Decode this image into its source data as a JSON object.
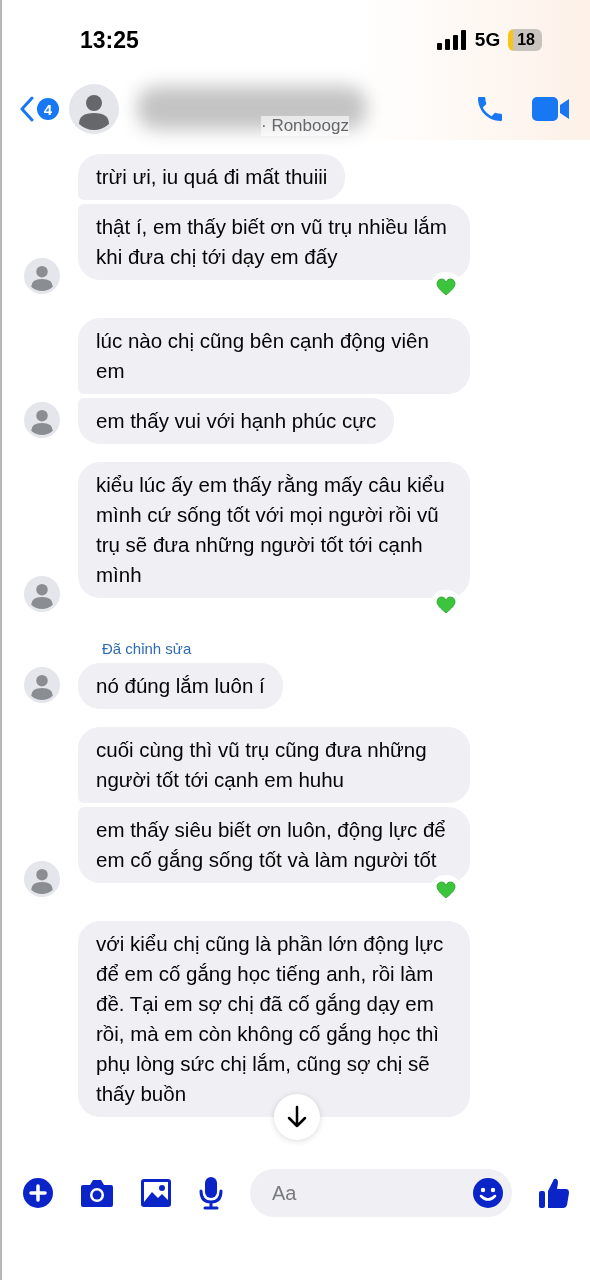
{
  "status_bar": {
    "time": "13:25",
    "network": "5G",
    "battery": "18"
  },
  "header": {
    "back_badge": "4",
    "subtitle": "· Ronboogz"
  },
  "groups": [
    {
      "show_avatar": true,
      "bubbles": [
        {
          "text": "trừi ưi, iu quá đi mất thuiii",
          "reacted": false
        },
        {
          "text": "thật í, em thấy biết ơn vũ trụ nhiều lắm khi đưa chị tới dạy em đấy",
          "reacted": true
        }
      ]
    },
    {
      "show_avatar": true,
      "bubbles": [
        {
          "text": "lúc nào chị cũng bên cạnh động viên em",
          "reacted": false
        },
        {
          "text": "em thấy vui với hạnh phúc cực",
          "reacted": false
        }
      ]
    },
    {
      "show_avatar": true,
      "bubbles": [
        {
          "text": "kiểu lúc ấy em thấy rằng mấy câu kiểu mình cứ sống tốt với mọi người rồi vũ trụ sẽ đưa những người tốt tới cạnh mình",
          "reacted": true
        }
      ]
    },
    {
      "show_avatar": true,
      "edited_label": "Đã chỉnh sửa",
      "bubbles": [
        {
          "text": "nó đúng lắm luôn í",
          "reacted": false
        }
      ]
    },
    {
      "show_avatar": true,
      "bubbles": [
        {
          "text": "cuối cùng thì vũ trụ cũng đưa những người tốt tới cạnh em huhu",
          "reacted": false
        },
        {
          "text": "em thấy siêu biết ơn luôn, động lực để em cố gắng sống tốt và làm người tốt",
          "reacted": true
        }
      ]
    },
    {
      "show_avatar": false,
      "bubbles": [
        {
          "text": "với kiểu chị cũng là phần lớn động lực để em cố gắng học tiếng anh, rồi làm đề. Tại em sợ chị đã cố gắng dạy em rồi, mà em còn không cố gắng học thì phụ lòng sức chị lắm, cũng sợ chị sẽ thấy buồn",
          "reacted": false
        }
      ]
    }
  ],
  "composer": {
    "placeholder": "Aa"
  }
}
